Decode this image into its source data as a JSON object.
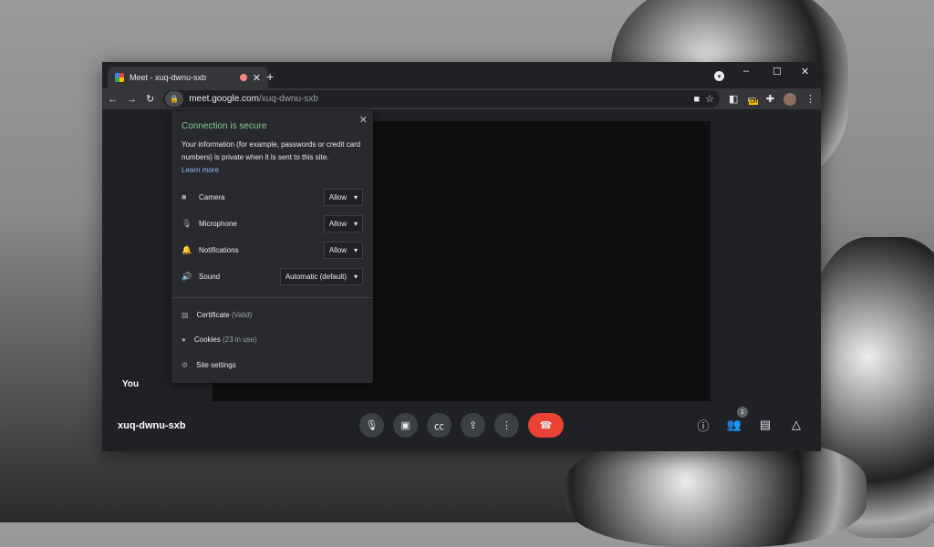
{
  "browser": {
    "tab_title": "Meet - xuq-dwnu-sxb",
    "url_host": "meet.google.com",
    "url_path": "/xuq-dwnu-sxb",
    "ext_badge": "Off"
  },
  "popup": {
    "title": "Connection is secure",
    "description": "Your information (for example, passwords or credit card numbers) is private when it is sent to this site.",
    "learn_more": "Learn more",
    "permissions": [
      {
        "label": "Camera",
        "value": "Allow",
        "icon": "camera-icon"
      },
      {
        "label": "Microphone",
        "value": "Allow",
        "icon": "microphone-icon"
      },
      {
        "label": "Notifications",
        "value": "Allow",
        "icon": "bell-icon"
      },
      {
        "label": "Sound",
        "value": "Automatic (default)",
        "icon": "speaker-icon"
      }
    ],
    "certificate": "Certificate",
    "certificate_status": "(Valid)",
    "cookies": "Cookies",
    "cookies_status": "(23 in use)",
    "site_settings": "Site settings"
  },
  "meet": {
    "self_label": "You",
    "meeting_code": "xuq-dwnu-sxb",
    "participants_count": "1",
    "end_call_color": "#ea4335"
  }
}
